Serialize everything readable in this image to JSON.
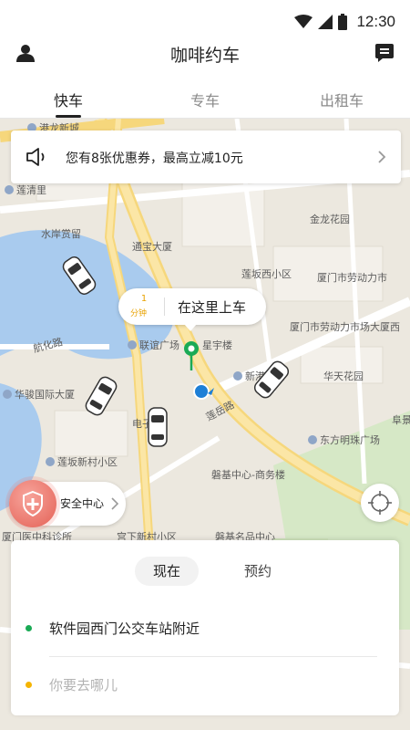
{
  "status_bar": {
    "time": "12:30"
  },
  "header": {
    "title": "咖啡约车"
  },
  "tabs": [
    {
      "label": "快车",
      "active": true
    },
    {
      "label": "专车",
      "active": false
    },
    {
      "label": "出租车",
      "active": false
    }
  ],
  "coupon": {
    "text": "您有8张优惠券，最高立减10元"
  },
  "pickup": {
    "eta_value": "1",
    "eta_unit": "分钟",
    "label": "在这里上车"
  },
  "map_labels": [
    "港龙新城",
    "莲清里",
    "水岸赏留",
    "通宝大厦",
    "金龙花园",
    "莲坂西小区",
    "厦门市劳动力市",
    "厦门市劳动力市场大厦西",
    "联谊广场",
    "星宇楼",
    "新港广场",
    "华天花园",
    "华骏国际大厦",
    "电子城",
    "莲岳路",
    "阜景",
    "东方明珠广场",
    "莲坂新村小区",
    "磐基中心-商务楼",
    "航化路",
    "宫下新村小区",
    "厦门医中科诊所",
    "磐基名品中心"
  ],
  "safety": {
    "label": "安全中心"
  },
  "trip": {
    "mode_now": "现在",
    "mode_reserve": "预约",
    "from": "软件园西门公交车站附近",
    "to_placeholder": "你要去哪儿"
  },
  "colors": {
    "accent_eta": "#e8a200",
    "pin_green": "#1aaa55",
    "from_dot": "#1aaa55",
    "to_dot": "#f5b400",
    "location_blue": "#1e7fd6",
    "safety_red": "#e46156"
  },
  "icons": {
    "profile": "person-icon",
    "message": "message-icon",
    "coupon": "speaker-icon",
    "locate": "crosshair-icon",
    "safety": "shield-plus-icon"
  }
}
